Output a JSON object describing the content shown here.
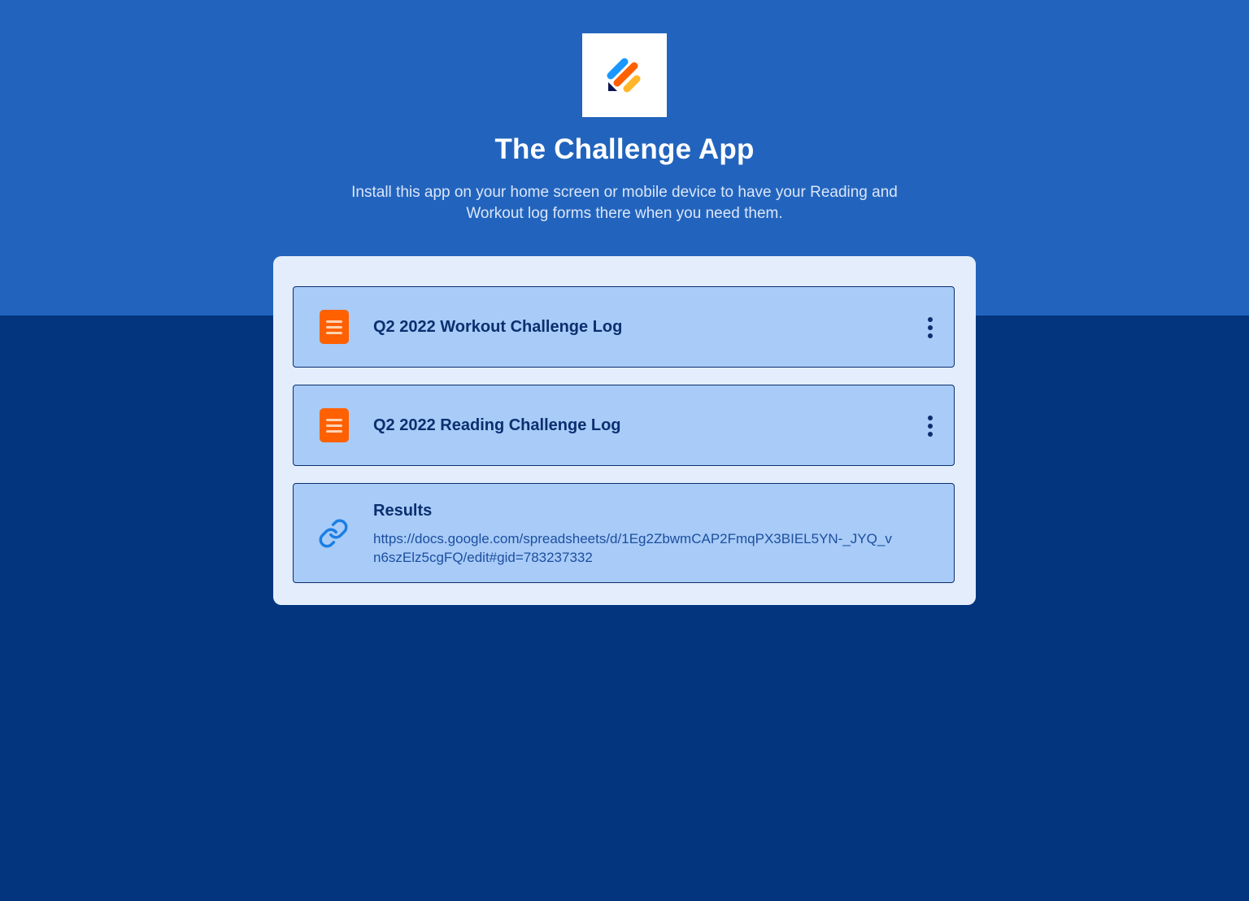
{
  "app": {
    "title": "The Challenge App",
    "description": "Install this app on your home screen or mobile device to have your Reading and Workout log forms there when you need them."
  },
  "items": [
    {
      "type": "form",
      "label": "Q2 2022 Workout Challenge Log",
      "icon": "form-icon",
      "menu_icon": "more-vertical-icon"
    },
    {
      "type": "form",
      "label": "Q2 2022 Reading Challenge Log",
      "icon": "form-icon",
      "menu_icon": "more-vertical-icon"
    }
  ],
  "link": {
    "title": "Results",
    "url": "https://docs.google.com/spreadsheets/d/1Eg2ZbwmCAP2FmqPX3BIEL5YN-_JYQ_vn6szElz5cgFQ/edit#gid=783237332",
    "icon": "link-icon"
  },
  "colors": {
    "top_band": "#2264bd",
    "bottom_band": "#02357e",
    "panel": "#e4edfc",
    "item_bg": "#a8cbf8",
    "item_border": "#0b2f6e",
    "form_icon": "#ff6100",
    "link_icon": "#1a7ee6"
  }
}
